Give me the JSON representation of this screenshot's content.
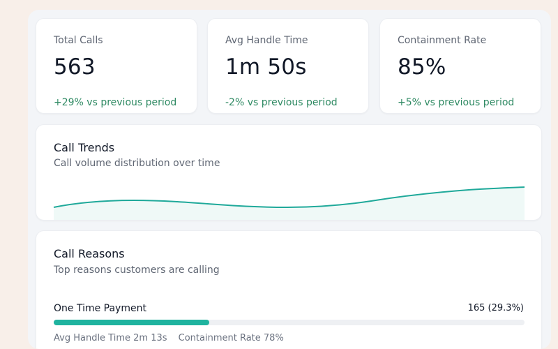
{
  "kpis": [
    {
      "label": "Total Calls",
      "value": "563",
      "change": "+29% vs previous period"
    },
    {
      "label": "Avg Handle Time",
      "value": "1m 50s",
      "change": "-2% vs previous period"
    },
    {
      "label": "Containment Rate",
      "value": "85%",
      "change": "+5% vs previous period"
    }
  ],
  "trends": {
    "title": "Call Trends",
    "subtitle": "Call volume distribution over time",
    "line_color": "#1fa99a"
  },
  "reasons": {
    "title": "Call Reasons",
    "subtitle": "Top reasons customers are calling",
    "items": [
      {
        "name": "One Time Payment",
        "count": "165 (29.3%)",
        "share": 0.33,
        "avg_handle": "Avg Handle Time 2m 13s",
        "containment": "Containment Rate 78%"
      }
    ]
  },
  "colors": {
    "accent": "#1fb39f",
    "positive": "#2f8a63"
  }
}
